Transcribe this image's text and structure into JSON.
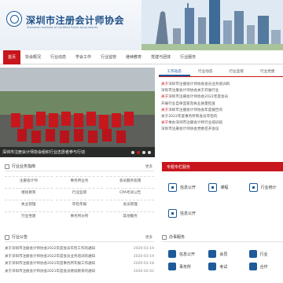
{
  "header": {
    "title": "深圳市注册会计师协会",
    "subtitle": "Shenzhen Institute of Certified Public Accountants"
  },
  "nav": {
    "items": [
      "首页",
      "协会概况",
      "行业动态",
      "学会工作",
      "行业监管",
      "继续教育",
      "党建与团体",
      "行业服务"
    ],
    "active_index": 0
  },
  "slider": {
    "caption": "深圳市注册会计师协会组织行业志愿者参与行动",
    "dots": 4,
    "active_dot": 1
  },
  "news": {
    "tabs": [
      "工作动态",
      "行业动态",
      "行业监管",
      "行业党建"
    ],
    "active_tab": 0,
    "lines": [
      {
        "hl": "关于",
        "text": "深圳市注册会计师协会会员业务培训的"
      },
      {
        "hl": "",
        "text": "深圳市注册会计师协会关于开展行业"
      },
      {
        "hl": "关于",
        "text": "深圳市注册会计师协会2022年度会员"
      },
      {
        "hl": "",
        "text": "开展行业自律监管及执业质量检查"
      },
      {
        "hl": "关于",
        "text": "深圳市注册会计师协会年度报告的"
      },
      {
        "hl": "",
        "text": "关于2022年度事务所和会员年检的"
      },
      {
        "hl": "关于",
        "text": "举办深圳市注册会计师行业培训班"
      },
      {
        "hl": "",
        "text": "深圳市注册会计师协会党委召开会议"
      }
    ]
  },
  "services": {
    "title": "行业业务指南",
    "more": "更多",
    "items": [
      "注册会计师",
      "事务所业务",
      "会员服务指南",
      "继续教育",
      "行业监管",
      "CPA考试公告",
      "执业管理",
      "年检年报",
      "会员管理",
      "行业党建",
      "事务所分所",
      "其他服务"
    ]
  },
  "special": {
    "title": "专题专栏服务",
    "items": [
      "信息公开",
      "课程",
      "行业统计",
      "信息公开"
    ]
  },
  "notices": {
    "title": "行业公告",
    "more": "更多",
    "items": [
      {
        "title": "关于深圳市注册会计师协会2022年度会员年检工作的通知",
        "date": "2020-03-19"
      },
      {
        "title": "关于深圳市注册会计师协会2022年度会员业务培训的通知",
        "date": "2020-03-19"
      },
      {
        "title": "关于深圳市注册会计师协会2021年度事务所年报工作通知",
        "date": "2020-03-18"
      },
      {
        "title": "关于深圳市注册会计师协会2021年度会员继续教育的通知",
        "date": "2020-02-02"
      }
    ]
  },
  "affairs": {
    "title": "办事服务",
    "items": [
      "信息公开",
      "会员",
      "行业",
      "事务所",
      "考试",
      "合作"
    ]
  }
}
